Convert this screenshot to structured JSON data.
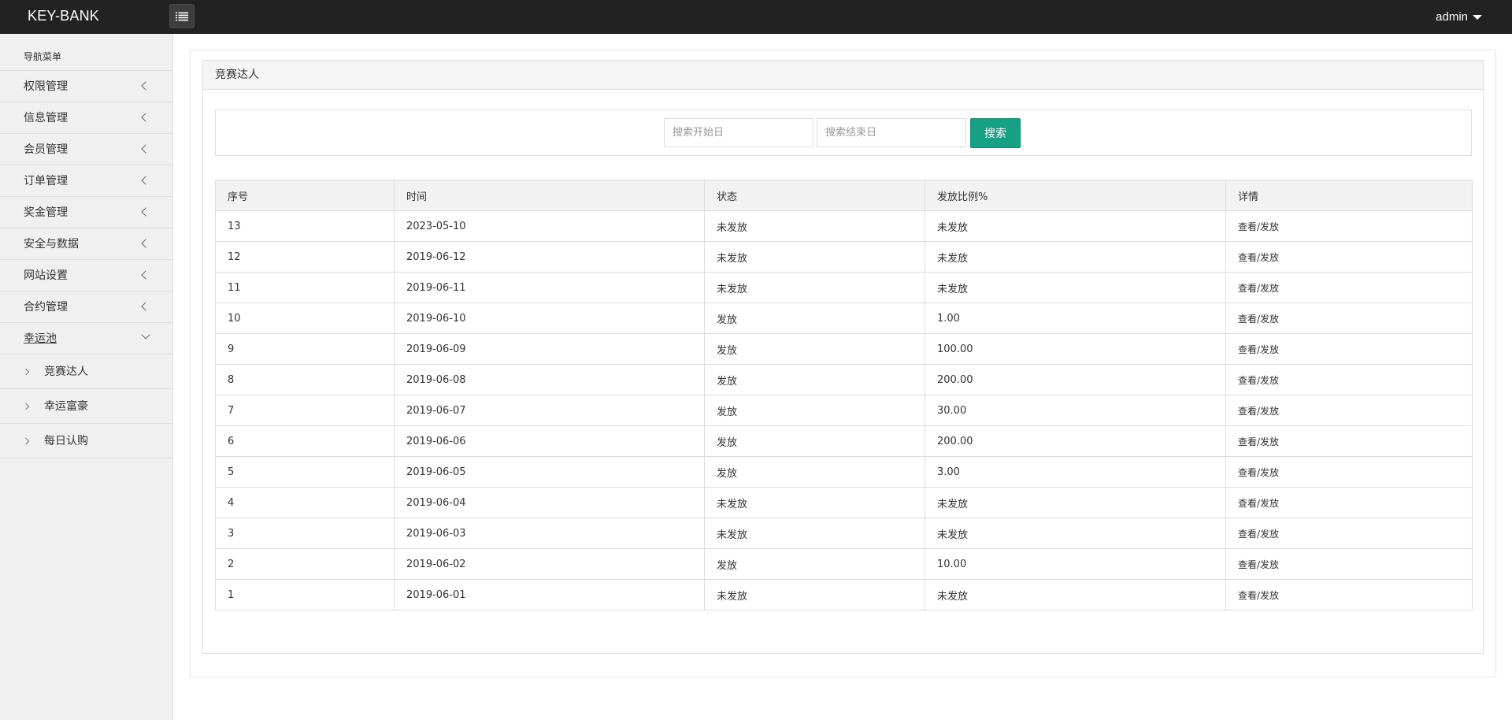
{
  "app": {
    "brand": "KEY-BANK",
    "menu_icon": "list-icon",
    "user": "admin"
  },
  "sidebar": {
    "header": "导航菜单",
    "items": [
      {
        "label": "权限管理"
      },
      {
        "label": "信息管理"
      },
      {
        "label": "会员管理"
      },
      {
        "label": "订单管理"
      },
      {
        "label": "奖金管理"
      },
      {
        "label": "安全与数据"
      },
      {
        "label": "网站设置"
      },
      {
        "label": "合约管理"
      },
      {
        "label": "幸运池"
      }
    ],
    "subitems": [
      {
        "label": "竞赛达人"
      },
      {
        "label": "幸运富豪"
      },
      {
        "label": "每日认购"
      }
    ]
  },
  "panel": {
    "title": "竞赛达人"
  },
  "search": {
    "start_placeholder": "搜索开始日",
    "end_placeholder": "搜索结束日",
    "button_label": "搜索"
  },
  "table": {
    "headers": [
      "序号",
      "时间",
      "状态",
      "发放比例%",
      "详情"
    ],
    "rows": [
      {
        "id": "13",
        "date": "2023-05-10",
        "status": "未发放",
        "ratio": "未发放",
        "detail": "查看/发放"
      },
      {
        "id": "12",
        "date": "2019-06-12",
        "status": "未发放",
        "ratio": "未发放",
        "detail": "查看/发放"
      },
      {
        "id": "11",
        "date": "2019-06-11",
        "status": "未发放",
        "ratio": "未发放",
        "detail": "查看/发放"
      },
      {
        "id": "10",
        "date": "2019-06-10",
        "status": "发放",
        "ratio": "1.00",
        "detail": "查看/发放"
      },
      {
        "id": "9",
        "date": "2019-06-09",
        "status": "发放",
        "ratio": "100.00",
        "detail": "查看/发放"
      },
      {
        "id": "8",
        "date": "2019-06-08",
        "status": "发放",
        "ratio": "200.00",
        "detail": "查看/发放"
      },
      {
        "id": "7",
        "date": "2019-06-07",
        "status": "发放",
        "ratio": "30.00",
        "detail": "查看/发放"
      },
      {
        "id": "6",
        "date": "2019-06-06",
        "status": "发放",
        "ratio": "200.00",
        "detail": "查看/发放"
      },
      {
        "id": "5",
        "date": "2019-06-05",
        "status": "发放",
        "ratio": "3.00",
        "detail": "查看/发放"
      },
      {
        "id": "4",
        "date": "2019-06-04",
        "status": "未发放",
        "ratio": "未发放",
        "detail": "查看/发放"
      },
      {
        "id": "3",
        "date": "2019-06-03",
        "status": "未发放",
        "ratio": "未发放",
        "detail": "查看/发放"
      },
      {
        "id": "2",
        "date": "2019-06-02",
        "status": "发放",
        "ratio": "10.00",
        "detail": "查看/发放"
      },
      {
        "id": "1",
        "date": "2019-06-01",
        "status": "未发放",
        "ratio": "未发放",
        "detail": "查看/发放"
      }
    ]
  },
  "colors": {
    "topbar": "#222222",
    "sidebar": "#f0f0f0",
    "accent": "#16a085"
  }
}
